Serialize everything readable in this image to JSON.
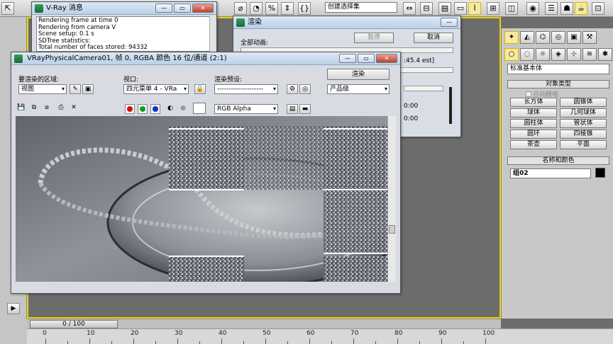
{
  "toolbar": {
    "selection_set_placeholder": "创建选择集",
    "buttons": [
      "select-tool",
      "percent-snap",
      "spinner-snap",
      "named-sel",
      "mirror",
      "align",
      "layers",
      "curve-editor",
      "schematic",
      "material-editor",
      "render-setup",
      "render-frame",
      "quick-render"
    ]
  },
  "vray_messages": {
    "title": "V-Ray 消息",
    "lines": [
      "Rendering frame at time 0",
      "Rendering from camera V",
      "Scene setup: 0.1 s",
      "SDTree statistics:",
      "Total number of faces stored: 94332"
    ]
  },
  "render_dialog": {
    "title": "渲染",
    "all_anim_label": "全部动画:",
    "pause_label": "暂停",
    "cancel_label": "取消",
    "est_text": ":45.4 est]",
    "time_1": "0:00",
    "time_2": "0:00"
  },
  "frame_buffer": {
    "title": "VRayPhysicalCamera01, 帧 0, RGBA 颜色 16 位/通道 (2:1)",
    "area_label": "要渲染的区域:",
    "area_value": "视图",
    "viewport_label": "视口:",
    "viewport_value": "四元菜单 4 - VRa",
    "preset_label": "渲染预设:",
    "preset_value": "--------------------",
    "render_button": "渲染",
    "quality_value": "产品级",
    "channel_value": "RGB Alpha",
    "colors": {
      "red": "#d01010",
      "green": "#10a020",
      "blue": "#1030d0"
    }
  },
  "command_panel": {
    "category": "标准基本体",
    "object_type_header": "对象类型",
    "autogrid_label": "自动栅格",
    "objects": [
      "长方体",
      "圆锥体",
      "球体",
      "几何球体",
      "圆柱体",
      "管状体",
      "圆环",
      "四棱锥",
      "茶壶",
      "平面"
    ],
    "name_color_header": "名称和颜色",
    "object_name": "组02"
  },
  "timeline": {
    "slider_text": "0 / 100",
    "ticks": [
      "0",
      "10",
      "20",
      "30",
      "40",
      "50",
      "60",
      "70",
      "80",
      "90",
      "100"
    ]
  }
}
